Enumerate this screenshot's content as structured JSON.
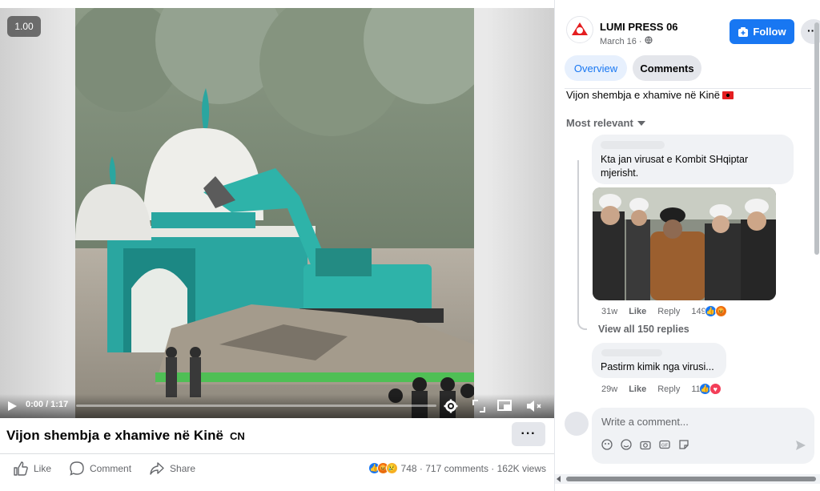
{
  "video": {
    "speed_badge": "1.00",
    "time": "0:00 / 1:17",
    "progress": 0.0
  },
  "post": {
    "title": "Vijon shembja e xhamive në Kinë",
    "title_flag": "CN",
    "more_label": "···",
    "actions": {
      "like": "Like",
      "comment": "Comment",
      "share": "Share"
    },
    "reaction_count": "748",
    "comments_count": "717 comments",
    "views_count": "162K views"
  },
  "panel": {
    "page_name": "LUMI PRESS 06",
    "page_date": "March 16 · ",
    "follow_label": "Follow",
    "dots_label": "··",
    "tabs": {
      "overview": "Overview",
      "comments": "Comments"
    },
    "caption": "Vijon shembja e xhamive në Kinë",
    "sort_label": "Most relevant",
    "comments": [
      {
        "text": "Kta jan virusat e Kombit SHqiptar mjerisht.",
        "time": "31w",
        "like": "Like",
        "reply": "Reply",
        "reactions": "149"
      },
      {
        "text": "Pastirm kimik nga virusi...",
        "time": "29w",
        "like": "Like",
        "reply": "Reply",
        "reactions": "11"
      }
    ],
    "view_replies": "View all 150 replies",
    "composer_placeholder": "Write a comment..."
  },
  "colors": {
    "accent": "#1877f2",
    "secondary_text": "#65676b",
    "bubble": "#f0f2f5"
  }
}
